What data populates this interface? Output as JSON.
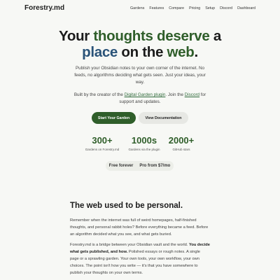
{
  "nav": {
    "brand": "Forestry.md",
    "links": [
      "Gardens",
      "Features",
      "Compare",
      "Pricing",
      "Setup",
      "Discord",
      "Dashboard"
    ]
  },
  "hero": {
    "title_parts": [
      "Your ",
      "thoughts deserve",
      " a ",
      "place",
      " on the ",
      "web",
      "."
    ],
    "lede": "Publish your Obsidian notes to your own corner of the internet. No feeds, no algorithms deciding what gets seen. Just your ideas, your way.",
    "credit": {
      "prefix": "Built by the creator of the ",
      "plugin_link": "Digital Garden plugin",
      "middle": ". Join the ",
      "discord_link": "Discord",
      "suffix": " for support and updates."
    },
    "primary_button": "Start Your Garden",
    "secondary_button": "View Documentation"
  },
  "stats": [
    {
      "value": "300+",
      "label": "Gardens on Forestry.md"
    },
    {
      "value": "1000s",
      "label": "Gardens via the plugin"
    },
    {
      "value": "2000+",
      "label": "GitHub stars"
    }
  ],
  "pricing": {
    "free": "Free forever",
    "pro": "Pro from $7/mo"
  },
  "section": {
    "title": "The web used to be personal.",
    "para1": "Remember when the internet was full of weird homepages, half-finished thoughts, and personal rabbit holes? Before everything became a feed. Before an algorithm decided what you see, and what gets buried.",
    "para2_prefix": "Forestry.md is a bridge between your Obsidian vault and the world. ",
    "para2_bold": "You decide what gets published, and how.",
    "para2_suffix": " Polished essays or rough notes. A single page or a sprawling garden. Your own tools, your own workflow, your own choices. The point isn't how you write — it's that you have somewhere to publish your thoughts on your own terms."
  },
  "colors": {
    "accent_green": "#2f5e2a",
    "accent_blue": "#2a5378",
    "background": "#f7f8f5"
  }
}
